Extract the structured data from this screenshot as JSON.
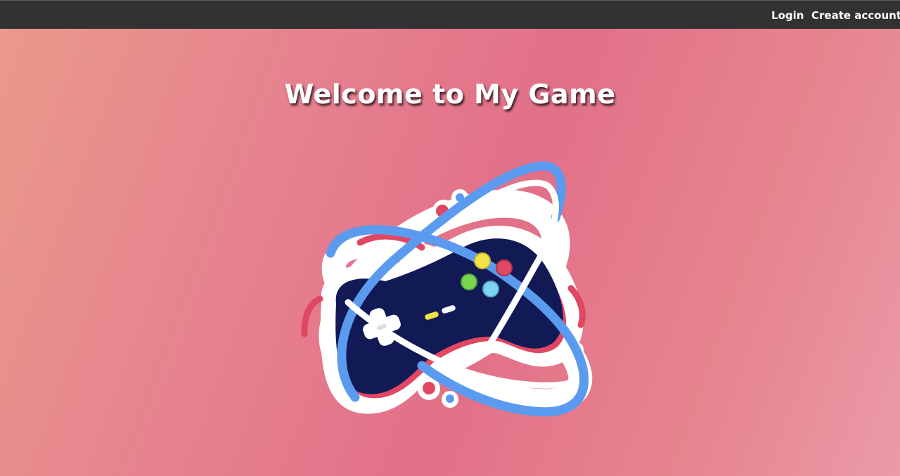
{
  "nav": {
    "login_label": "Login",
    "create_account_label": "Create account"
  },
  "hero": {
    "title": "Welcome to My Game",
    "logo_icon": "gamepad-icon"
  },
  "colors": {
    "topbar": "#323232",
    "background_start": "#ea9a8a",
    "background_end": "#eb9aa8",
    "controller_navy": "#111a55",
    "orbit_blue": "#5b9bef",
    "accent_red": "#e04763"
  }
}
